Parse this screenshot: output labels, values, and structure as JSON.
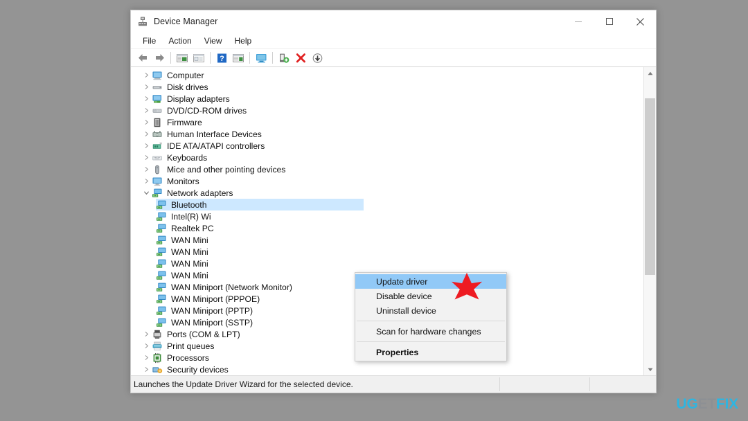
{
  "window": {
    "title": "Device Manager",
    "title_icon": "device-manager-icon",
    "minimize_label": "Minimize",
    "maximize_label": "Maximize",
    "close_label": "Close"
  },
  "menubar": {
    "items": [
      {
        "label": "File"
      },
      {
        "label": "Action"
      },
      {
        "label": "View"
      },
      {
        "label": "Help"
      }
    ]
  },
  "toolbar": {
    "buttons": [
      {
        "name": "back-arrow-icon",
        "tooltip": "Back"
      },
      {
        "name": "forward-arrow-icon",
        "tooltip": "Forward"
      },
      {
        "name": "show-hide-console-tree-icon",
        "tooltip": "Show/Hide console tree"
      },
      {
        "name": "properties-icon",
        "tooltip": "Properties"
      },
      {
        "name": "help-icon",
        "tooltip": "Help"
      },
      {
        "name": "view-icon",
        "tooltip": "View"
      },
      {
        "name": "scan-hardware-changes-icon",
        "tooltip": "Scan for hardware changes"
      },
      {
        "name": "update-driver-icon",
        "tooltip": "Update driver"
      },
      {
        "name": "uninstall-device-icon",
        "tooltip": "Uninstall device"
      },
      {
        "name": "disable-device-icon",
        "tooltip": "Disable device"
      }
    ]
  },
  "tree": {
    "items": [
      {
        "label": "Computer",
        "icon": "computer-icon",
        "level": 0,
        "expanded": false,
        "selected": false
      },
      {
        "label": "Disk drives",
        "icon": "disk-drive-icon",
        "level": 0,
        "expanded": false,
        "selected": false
      },
      {
        "label": "Display adapters",
        "icon": "display-adapter-icon",
        "level": 0,
        "expanded": false,
        "selected": false
      },
      {
        "label": "DVD/CD-ROM drives",
        "icon": "dvd-drive-icon",
        "level": 0,
        "expanded": false,
        "selected": false
      },
      {
        "label": "Firmware",
        "icon": "firmware-icon",
        "level": 0,
        "expanded": false,
        "selected": false
      },
      {
        "label": "Human Interface Devices",
        "icon": "hid-icon",
        "level": 0,
        "expanded": false,
        "selected": false
      },
      {
        "label": "IDE ATA/ATAPI controllers",
        "icon": "ide-controller-icon",
        "level": 0,
        "expanded": false,
        "selected": false
      },
      {
        "label": "Keyboards",
        "icon": "keyboard-icon",
        "level": 0,
        "expanded": false,
        "selected": false
      },
      {
        "label": "Mice and other pointing devices",
        "icon": "mouse-icon",
        "level": 0,
        "expanded": false,
        "selected": false
      },
      {
        "label": "Monitors",
        "icon": "monitor-icon",
        "level": 0,
        "expanded": false,
        "selected": false
      },
      {
        "label": "Network adapters",
        "icon": "network-adapter-icon",
        "level": 0,
        "expanded": true,
        "selected": false
      },
      {
        "label": "Bluetooth",
        "icon": "network-adapter-icon",
        "level": 1,
        "expanded": null,
        "selected": true
      },
      {
        "label": "Intel(R) Wi",
        "icon": "network-adapter-icon",
        "level": 1,
        "expanded": null,
        "selected": false
      },
      {
        "label": "Realtek PC",
        "icon": "network-adapter-icon",
        "level": 1,
        "expanded": null,
        "selected": false
      },
      {
        "label": "WAN Mini",
        "icon": "network-adapter-icon",
        "level": 1,
        "expanded": null,
        "selected": false
      },
      {
        "label": "WAN Mini",
        "icon": "network-adapter-icon",
        "level": 1,
        "expanded": null,
        "selected": false
      },
      {
        "label": "WAN Mini",
        "icon": "network-adapter-icon",
        "level": 1,
        "expanded": null,
        "selected": false
      },
      {
        "label": "WAN Mini",
        "icon": "network-adapter-icon",
        "level": 1,
        "expanded": null,
        "selected": false
      },
      {
        "label": "WAN Miniport (Network Monitor)",
        "icon": "network-adapter-icon",
        "level": 1,
        "expanded": null,
        "selected": false
      },
      {
        "label": "WAN Miniport (PPPOE)",
        "icon": "network-adapter-icon",
        "level": 1,
        "expanded": null,
        "selected": false
      },
      {
        "label": "WAN Miniport (PPTP)",
        "icon": "network-adapter-icon",
        "level": 1,
        "expanded": null,
        "selected": false
      },
      {
        "label": "WAN Miniport (SSTP)",
        "icon": "network-adapter-icon",
        "level": 1,
        "expanded": null,
        "selected": false
      },
      {
        "label": "Ports (COM & LPT)",
        "icon": "port-icon",
        "level": 0,
        "expanded": false,
        "selected": false
      },
      {
        "label": "Print queues",
        "icon": "printer-icon",
        "level": 0,
        "expanded": false,
        "selected": false
      },
      {
        "label": "Processors",
        "icon": "processor-icon",
        "level": 0,
        "expanded": false,
        "selected": false
      },
      {
        "label": "Security devices",
        "icon": "security-device-icon",
        "level": 0,
        "expanded": false,
        "selected": false
      }
    ]
  },
  "context_menu": {
    "items": [
      {
        "label": "Update driver",
        "highlighted": true,
        "bold": false,
        "separator_after": false
      },
      {
        "label": "Disable device",
        "highlighted": false,
        "bold": false,
        "separator_after": false
      },
      {
        "label": "Uninstall device",
        "highlighted": false,
        "bold": false,
        "separator_after": true
      },
      {
        "label": "Scan for hardware changes",
        "highlighted": false,
        "bold": false,
        "separator_after": true
      },
      {
        "label": "Properties",
        "highlighted": false,
        "bold": true,
        "separator_after": false
      }
    ]
  },
  "statusbar": {
    "text": "Launches the Update Driver Wizard for the selected device."
  },
  "annotation": {
    "star_name": "red-star-pointer",
    "star_color": "#ee1b22"
  },
  "watermark": {
    "part1": "UG",
    "part2": "ET",
    "part3": "FIX",
    "color_blue": "#2fb5e0",
    "color_gray": "#8d9094"
  },
  "colors": {
    "desktop_background": "#949494",
    "window_background": "#ffffff",
    "selection_blue": "#cde8ff",
    "menu_highlight_blue": "#91c9f7",
    "statusbar_background": "#f0f0f0",
    "scrollbar_thumb": "#cdcdcd"
  }
}
